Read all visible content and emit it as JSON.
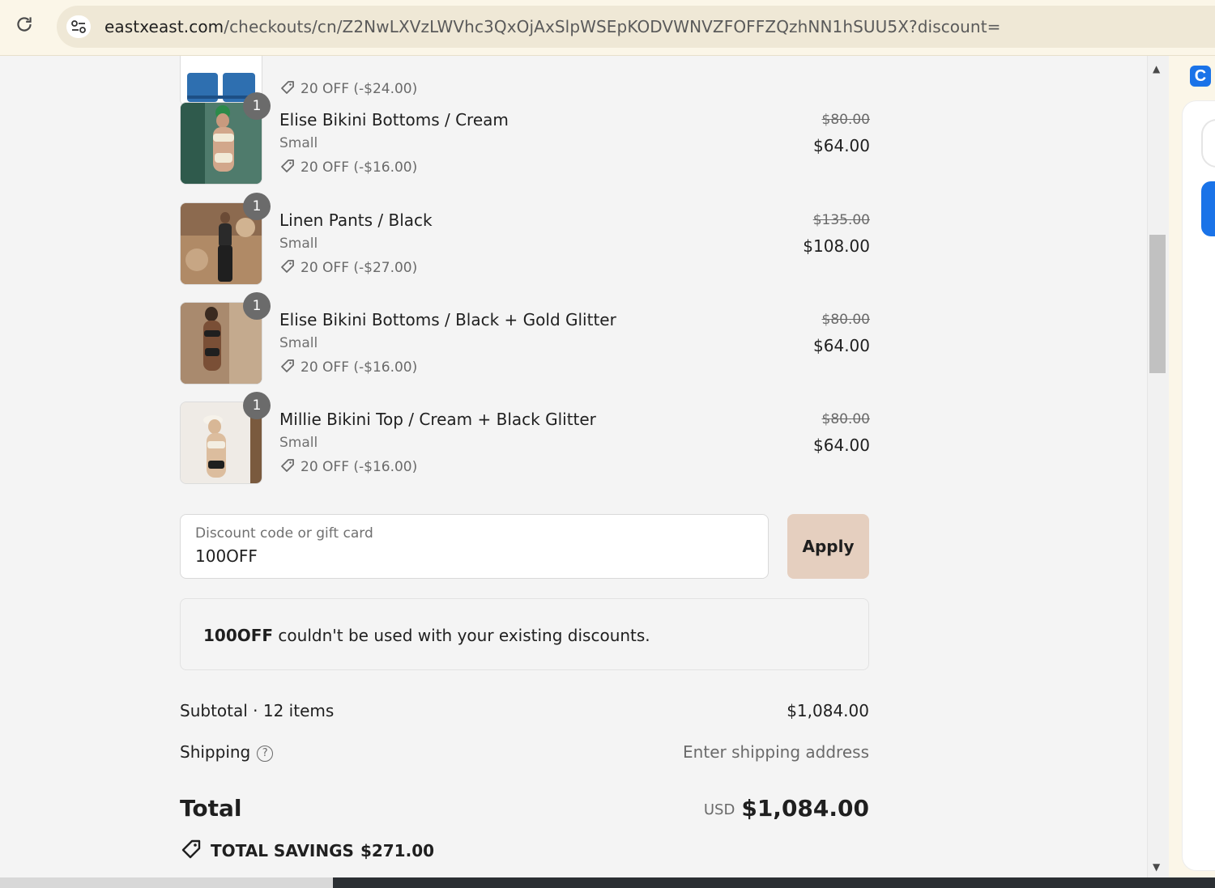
{
  "browser": {
    "url_host": "eastxeast.com",
    "url_path": "/checkouts/cn/Z2NwLXVzLWVhc3QxOjAxSlpWSEpKODVWNVZFOFFZQzhNN1hSUU5X?discount=",
    "reload_icon": "reload-icon",
    "site_info_icon": "tune-icon",
    "extension_label": "C"
  },
  "items": [
    {
      "name": "",
      "variant": "",
      "discount": "20 OFF (-$24.00)",
      "old_price": "",
      "price": "",
      "qty": ""
    },
    {
      "name": "Elise Bikini Bottoms / Cream",
      "variant": "Small",
      "discount": "20 OFF (-$16.00)",
      "old_price": "$80.00",
      "price": "$64.00",
      "qty": "1"
    },
    {
      "name": "Linen Pants / Black",
      "variant": "Small",
      "discount": "20 OFF (-$27.00)",
      "old_price": "$135.00",
      "price": "$108.00",
      "qty": "1"
    },
    {
      "name": "Elise Bikini Bottoms / Black + Gold Glitter",
      "variant": "Small",
      "discount": "20 OFF (-$16.00)",
      "old_price": "$80.00",
      "price": "$64.00",
      "qty": "1"
    },
    {
      "name": "Millie Bikini Top / Cream + Black Glitter",
      "variant": "Small",
      "discount": "20 OFF (-$16.00)",
      "old_price": "$80.00",
      "price": "$64.00",
      "qty": "1"
    }
  ],
  "discount_form": {
    "label": "Discount code or gift card",
    "value": "100OFF",
    "apply_label": "Apply"
  },
  "notice": {
    "code": "100OFF",
    "message": " couldn't be used with your existing discounts."
  },
  "summary": {
    "subtotal_label": "Subtotal · 12 items",
    "subtotal_value": "$1,084.00",
    "shipping_label": "Shipping",
    "shipping_value": "Enter shipping address",
    "total_label": "Total",
    "currency": "USD",
    "total_value": "$1,084.00",
    "savings_label": "TOTAL SAVINGS",
    "savings_value": "$271.00"
  },
  "colors": {
    "apply_bg": "#e5cfbf",
    "page_bg": "#f4f4f4",
    "browser_bg": "#fbf6e8"
  }
}
